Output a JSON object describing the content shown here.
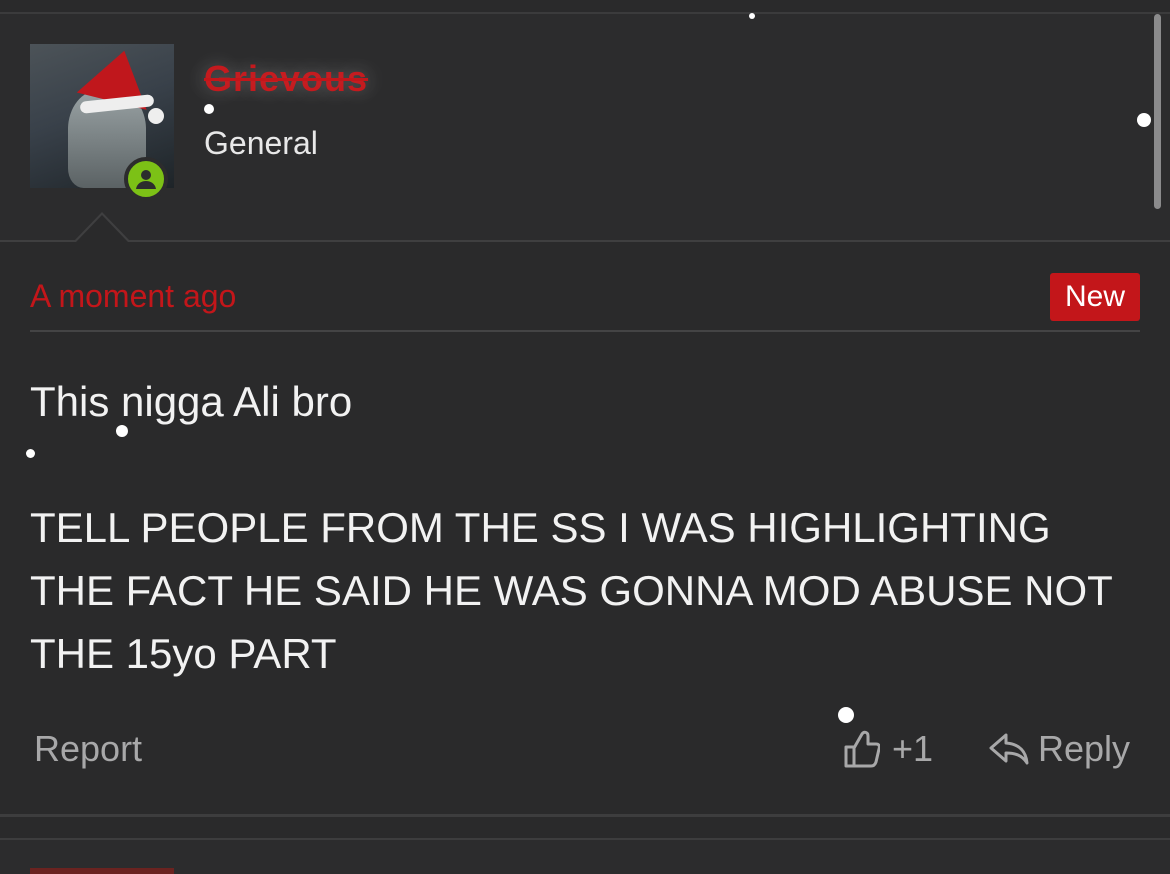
{
  "post": {
    "author": {
      "username": "Grievous",
      "title": "General",
      "online": true
    },
    "timestamp": "A moment ago",
    "badge": "New",
    "message_lines": [
      "This nigga Ali bro",
      "TELL PEOPLE FROM THE SS I WAS HIGHLIGHTING THE FACT HE SAID HE WAS GONNA MOD ABUSE NOT THE 15yo PART"
    ],
    "actions": {
      "report": "Report",
      "like_count": "+1",
      "reply": "Reply"
    }
  },
  "colors": {
    "accent_red": "#c3161a",
    "online_green": "#7cc116",
    "background": "#2a2a2b"
  },
  "icons": [
    "user-icon",
    "thumbs-up-icon",
    "reply-icon"
  ]
}
